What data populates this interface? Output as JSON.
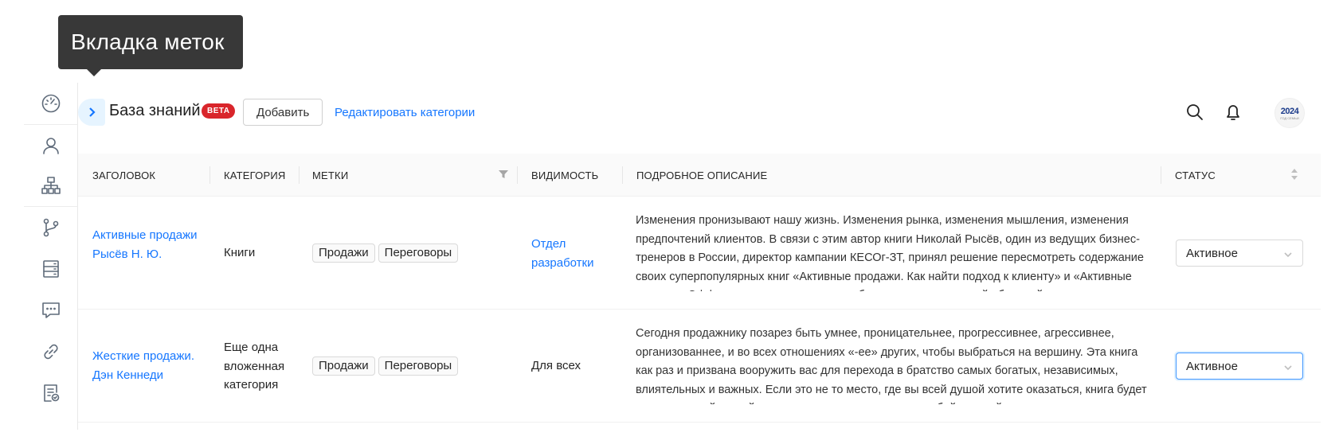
{
  "tooltip": {
    "text": "Вкладка меток"
  },
  "sidebar": {
    "items": [
      {
        "icon": "dashboard-icon"
      },
      {
        "icon": "user-icon"
      },
      {
        "icon": "org-structure-icon"
      },
      {
        "icon": "branch-icon"
      },
      {
        "icon": "database-icon"
      },
      {
        "icon": "chat-icon"
      },
      {
        "icon": "link-icon"
      },
      {
        "icon": "document-check-icon"
      }
    ]
  },
  "header": {
    "title": "База знаний",
    "badge": "BETA",
    "add_label": "Добавить",
    "edit_categories_label": "Редактировать категории",
    "avatar_year": "2024",
    "avatar_sub": "ГОД СЕМЬИ"
  },
  "table": {
    "columns": {
      "title": "ЗАГОЛОВОК",
      "category": "КАТЕГОРИЯ",
      "tags": "МЕТКИ",
      "visibility": "ВИДИМОСТЬ",
      "description": "ПОДРОБНОЕ ОПИСАНИЕ",
      "status": "СТАТУС"
    },
    "rows": [
      {
        "title": "Активные продажи Рысёв Н. Ю.",
        "category": "Книги",
        "tags": [
          "Продажи",
          "Переговоры"
        ],
        "visibility": "Отдел разработки",
        "visibility_is_link": true,
        "description": "Изменения пронизывают нашу жизнь. Изменения рынка, изменения мышления, изменения предпочтений клиентов. В связи с этим автор книги Николай Рысёв, один из ведущих бизнес-тренеров в России, директор кампании КЕСОг-ЗТ, принял решение пересмотреть содержание своих суперпопулярных книг «Активные продажи. Как найти подход к клиенту» и «Активные продажи. Эффективные переговоры» и объединить их под одной обложкой",
        "status": "Активное"
      },
      {
        "title": "Жесткие продажи. Дэн Кеннеди",
        "category": "Еще одна вложенная категория",
        "tags": [
          "Продажи",
          "Переговоры"
        ],
        "visibility": "Для всех",
        "visibility_is_link": false,
        "description": "Сегодня продажнику позарез быть умнее, проницательнее, прогрессивнее, агрессивнее, организованнее, и во всех отношениях «-ее» других, чтобы выбраться на вершину. Эта книга как раз и призвана вооружить вас для перехода в братство самых богатых, независимых, влиятельных и важных. Если это не то место, где вы всей душой хотите оказаться, книга будет для вас пустой тратой времени, покажется слишком грубой, прямой",
        "status": "Активное"
      }
    ]
  },
  "colors": {
    "accent": "#1677ff",
    "beta": "#d9252b",
    "tooltip_bg": "#383838"
  }
}
